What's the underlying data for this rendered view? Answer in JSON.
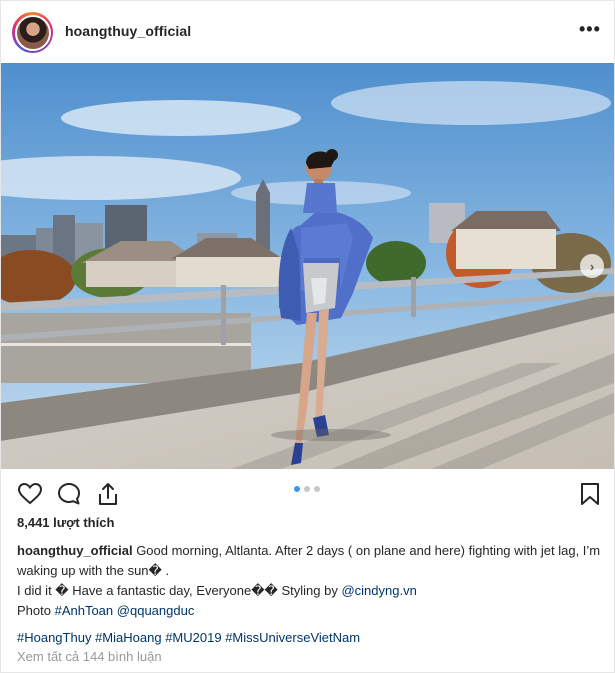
{
  "header": {
    "username": "hoangthuy_official",
    "more_icon": "more-horizontal-icon",
    "more_label": "•••"
  },
  "photo": {
    "next_icon": "chevron-right-icon",
    "next_label": "›",
    "slides": 3,
    "active_slide": 1
  },
  "actions": {
    "like_icon": "heart-icon",
    "comment_icon": "comment-icon",
    "share_icon": "share-icon",
    "save_icon": "bookmark-icon"
  },
  "likes": "8,441 lượt thích",
  "caption": {
    "username": "hoangthuy_official",
    "line1": "Good morning, Altlanta. After 2 days ( on plane and here) fighting with jet lag, I’m waking up with the sun� .",
    "line2_prefix": "I did it � Have a fantastic day, Everyone�� Styling by ",
    "line2_link": "@cindyng.vn",
    "line3_prefix": "Photo ",
    "line3_link1": "#AnhToan",
    "line3_link2": "@qquangduc"
  },
  "hashtags": [
    "#HoangThuy",
    "#MiaHoang",
    "#MU2019",
    "#MissUniverseVietNam"
  ],
  "view_comments": "Xem tất cả 144 bình luận",
  "colors": {
    "link": "#003569",
    "muted": "#999999",
    "dot_active": "#3897f0",
    "dot_inactive": "#c7c7c7"
  }
}
